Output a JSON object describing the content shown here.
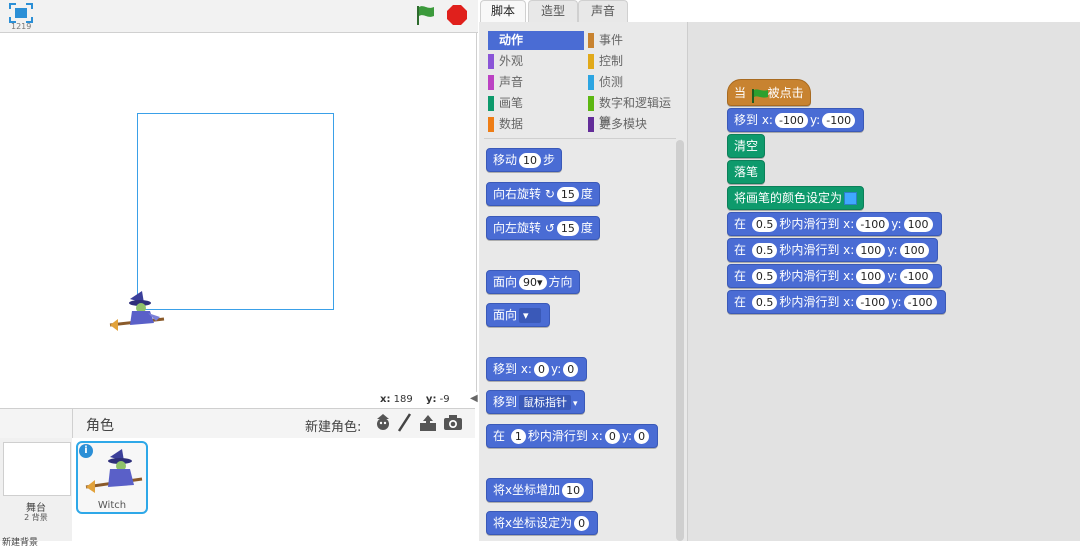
{
  "stage": {
    "version_label": "1219",
    "coords": {
      "x_label": "x:",
      "x_value": "189",
      "y_label": "y:",
      "y_value": "-9"
    }
  },
  "sprites_pane": {
    "title": "角色",
    "new_sprite_label": "新建角色:",
    "stage_label": "舞台",
    "stage_backdrops": "2 背景",
    "bottom_cut_text": "新建背景",
    "sprites": [
      {
        "name": "Witch"
      }
    ]
  },
  "tabs": [
    "脚本",
    "造型",
    "声音"
  ],
  "categories": [
    {
      "label": "动作",
      "color": "#4a6cd4"
    },
    {
      "label": "外观",
      "color": "#8a55d7"
    },
    {
      "label": "声音",
      "color": "#bb42c3"
    },
    {
      "label": "画笔",
      "color": "#0e9a6c"
    },
    {
      "label": "数据",
      "color": "#ee7d16"
    },
    {
      "label": "事件",
      "color": "#c88330"
    },
    {
      "label": "控制",
      "color": "#e1a91a"
    },
    {
      "label": "侦测",
      "color": "#2ca5e2"
    },
    {
      "label": "数字和逻辑运算",
      "color": "#5cb712"
    },
    {
      "label": "更多模块",
      "color": "#632d99"
    }
  ],
  "palette_blocks": {
    "move": {
      "pre": "移动",
      "v": "10",
      "post": "步"
    },
    "turn_right": {
      "pre": "向右旋转",
      "v": "15",
      "post": "度"
    },
    "turn_left": {
      "pre": "向左旋转",
      "v": "15",
      "post": "度"
    },
    "point_dir": {
      "pre": "面向",
      "v": "90▾",
      "post": "方向"
    },
    "point_towards": {
      "pre": "面向"
    },
    "goto_xy": {
      "pre": "移到 x:",
      "x": "0",
      "y_label": "y:",
      "y": "0"
    },
    "goto_target": {
      "pre": "移到",
      "v": "鼠标指针"
    },
    "glide": {
      "pre": "在",
      "t": "1",
      "mid": "秒内滑行到 x:",
      "x": "0",
      "y_label": "y:",
      "y": "0"
    },
    "change_x": {
      "pre": "将x坐标增加",
      "v": "10"
    },
    "set_x": {
      "pre": "将x坐标设定为",
      "v": "0"
    }
  },
  "script": {
    "hat": {
      "pre": "当",
      "post": "被点击"
    },
    "goto": {
      "pre": "移到 x:",
      "x": "-100",
      "y_label": "y:",
      "y": "-100"
    },
    "clear": "清空",
    "pen_down": "落笔",
    "set_pen_color": "将画笔的颜色设定为",
    "glides": [
      {
        "pre": "在",
        "t": "0.5",
        "mid": "秒内滑行到 x:",
        "x": "-100",
        "y_label": "y:",
        "y": "100"
      },
      {
        "pre": "在",
        "t": "0.5",
        "mid": "秒内滑行到 x:",
        "x": "100",
        "y_label": "y:",
        "y": "100"
      },
      {
        "pre": "在",
        "t": "0.5",
        "mid": "秒内滑行到 x:",
        "x": "100",
        "y_label": "y:",
        "y": "-100"
      },
      {
        "pre": "在",
        "t": "0.5",
        "mid": "秒内滑行到 x:",
        "x": "-100",
        "y_label": "y:",
        "y": "-100"
      }
    ]
  },
  "colors": {
    "motion": "#4a6cd4",
    "pen": "#0e9a6c",
    "event": "#c88330",
    "pen_color": "#3fa8ff",
    "flag": "#2e8b2e",
    "stop": "#e0201c"
  }
}
